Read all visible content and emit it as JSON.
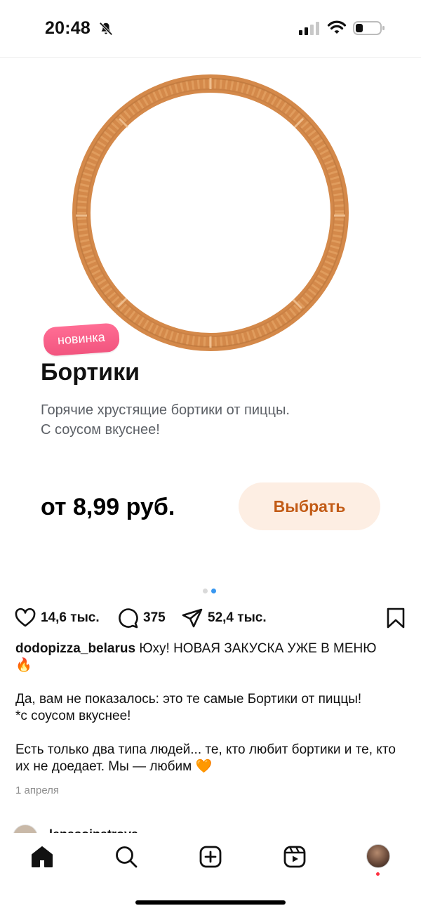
{
  "status_bar": {
    "time": "20:48",
    "icons": [
      "bell-slash-icon",
      "signal-icon",
      "wifi-icon",
      "battery-icon"
    ]
  },
  "post": {
    "badge": "новинка",
    "product_title": "Бортики",
    "product_description_line1": "Горячие хрустящие бортики от пиццы.",
    "product_description_line2": "С соусом вкуснее!",
    "price": "от 8,99 руб.",
    "select_button": "Выбрать",
    "carousel": {
      "total": 2,
      "active_index": 1
    },
    "likes": "14,6 тыс.",
    "comments": "375",
    "shares": "52,4 тыс.",
    "caption": {
      "username": "dodopizza_belarus",
      "line1": "Юху! НОВАЯ ЗАКУСКА УЖЕ В МЕНЮ",
      "emoji1": "🔥",
      "para2_line1": "Да, вам не показалось: это те самые Бортики от пиццы!",
      "para2_line2": "*с соусом вкуснее!",
      "para3": "Есть только два типа людей... те, кто любит бортики и те, кто их не доедает. Мы — любим",
      "emoji2": "🧡"
    },
    "date": "1 апреля",
    "next_comment_user": "lenasoinatrova"
  },
  "tabbar": {
    "items": [
      "home-icon",
      "search-icon",
      "create-icon",
      "reels-icon",
      "profile-avatar"
    ]
  },
  "colors": {
    "badge": "#f2557f",
    "select_button_bg": "#fdeee3",
    "select_button_text": "#c25b16",
    "active_dot": "#3897f0",
    "notification": "#ff3040"
  }
}
